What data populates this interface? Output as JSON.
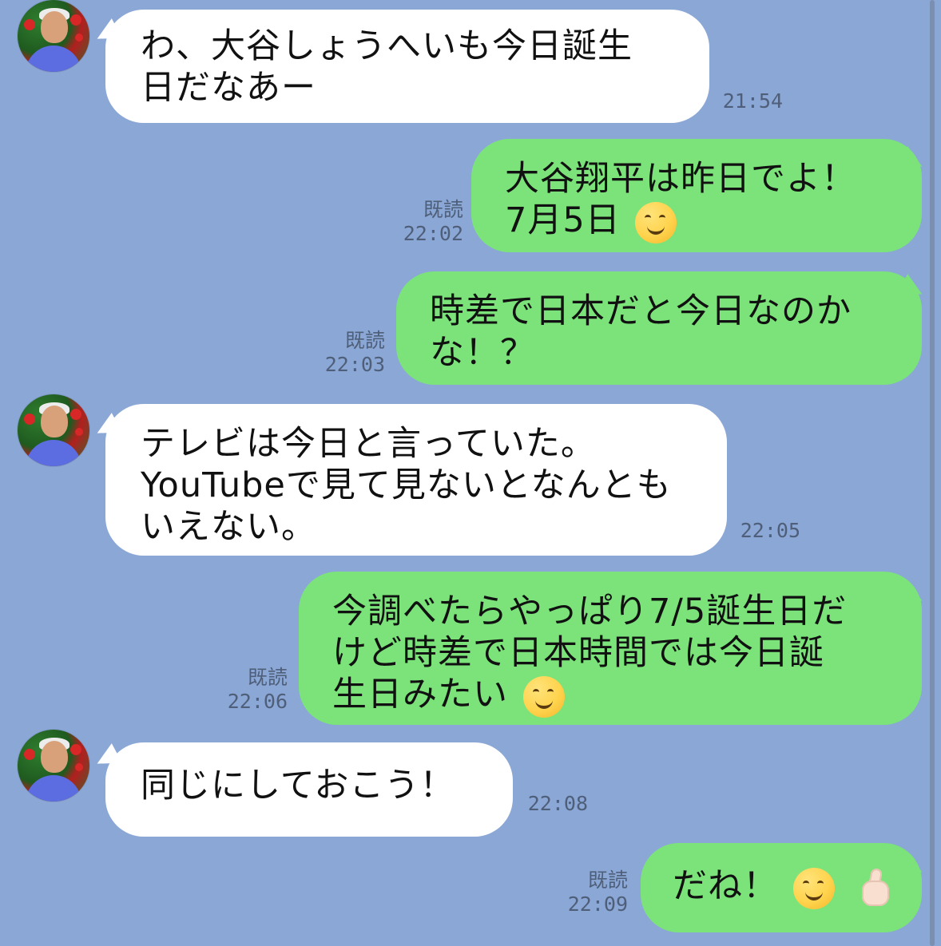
{
  "messages": [
    {
      "side": "left",
      "lines": [
        "わ、大谷しょうへいも今日誕生",
        "日だなあー"
      ],
      "time": "21:54"
    },
    {
      "side": "right",
      "lines": [
        "大谷翔平は昨日でよ！",
        "7月5日"
      ],
      "emoji_after_line_2": "smiling-face-emoji",
      "read_label": "既読",
      "time": "22:02"
    },
    {
      "side": "right",
      "lines": [
        "時差で日本だと今日なのか",
        "な！？"
      ],
      "read_label": "既読",
      "time": "22:03"
    },
    {
      "side": "left",
      "lines": [
        "テレビは今日と言っていた。",
        "YouTubeで見て見ないとなんとも",
        "いえない。"
      ],
      "time": "22:05"
    },
    {
      "side": "right",
      "lines": [
        "今調べたらやっぱり7/5誕生日だ",
        "けど時差で日本時間では今日誕",
        "生日みたい"
      ],
      "emoji_after_line_3": "smiling-face-emoji",
      "read_label": "既読",
      "time": "22:06"
    },
    {
      "side": "left",
      "lines": [
        "同じにしておこう！"
      ],
      "time": "22:08"
    },
    {
      "side": "right",
      "lines": [
        "だね！"
      ],
      "emojis": [
        "smiling-face-emoji",
        "thumbs-up-emoji"
      ],
      "read_label": "既読",
      "time": "22:09"
    }
  ],
  "colors": {
    "background": "#8aa7d6",
    "incoming_bubble": "#ffffff",
    "outgoing_bubble": "#7be37a",
    "meta_text": "#4f5f79"
  },
  "icons": {
    "avatar": "avatar-icon",
    "smile": "smiling-face-icon",
    "thumbs_up": "thumbs-up-icon"
  }
}
